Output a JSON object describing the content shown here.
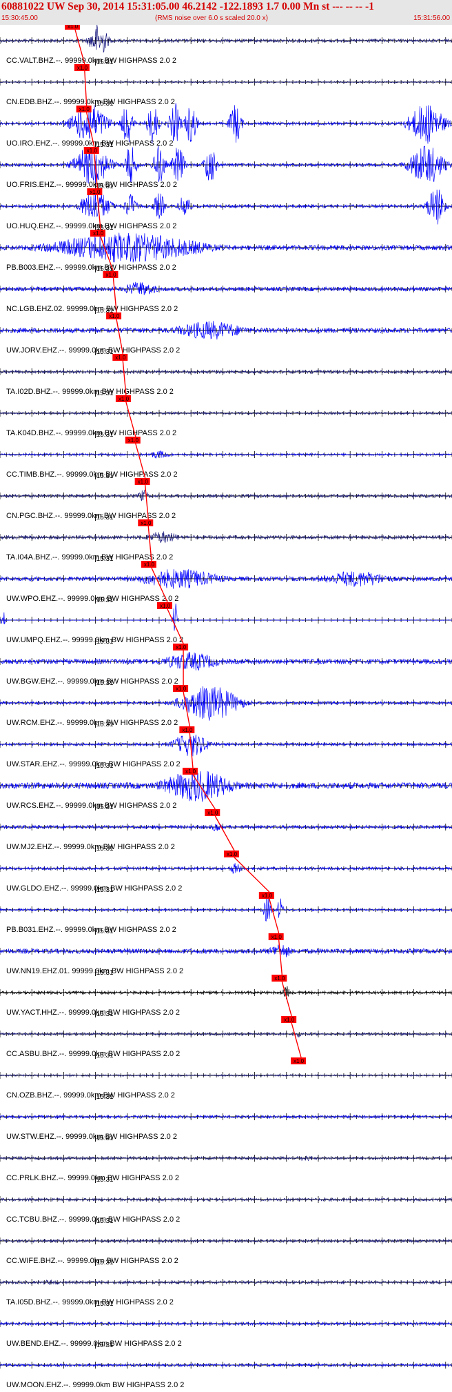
{
  "header": {
    "title": "60881022 UW Sep 30, 2014 15:31:05.00   46.2142 -122.1893  1.7 0.00 Mn st --- -- --  -1",
    "start_time": "15:30:45.00",
    "note": "(RMS noise over 6.0 s scaled 20.0 x)",
    "end_time": "15:31:56.00"
  },
  "colors": {
    "title": "#d40000",
    "trace_blue": "#0000ff",
    "trace_navy": "#1a1a80",
    "pick_red": "#ff0000",
    "header_bg": "#e6e6e6"
  },
  "chart_data": {
    "type": "seismogram",
    "time_range": [
      "15:30:45.00",
      "15:31:56.00"
    ],
    "minute_label": "15:31",
    "pick_label": "x1.0",
    "filter": "99999.0km BW  HIGHPASS  2.0  2",
    "stations": [
      {
        "net": "CC",
        "sta": "VALT",
        "cha": "BHZ",
        "loc": "--",
        "label": "CC.VALT.BHZ.--. 99999.0km BW  HIGHPASS  2.0  2",
        "color": "navy",
        "pick_s": 10.5,
        "events": [
          [
            15.5,
            1.5,
            2.6
          ]
        ],
        "noise": 0.22
      },
      {
        "net": "CN",
        "sta": "EDB",
        "cha": "BHZ",
        "loc": "--",
        "label": "CN.EDB.BHZ.--. 99999.0km BW  HIGHPASS  2.0  2",
        "color": "navy",
        "pick_s": 12.0,
        "events": [],
        "noise": 0.1
      },
      {
        "net": "UO",
        "sta": "IRO",
        "cha": "EHZ",
        "loc": "--",
        "label": "UO.IRO.EHZ.--. 99999.0km BW  HIGHPASS  2.0  2",
        "color": "blue",
        "pick_s": 12.3,
        "events": [
          [
            14,
            3,
            3
          ],
          [
            20,
            1,
            3
          ],
          [
            24,
            1,
            3
          ],
          [
            27.5,
            1,
            3
          ],
          [
            30,
            1,
            3
          ],
          [
            37,
            1,
            3
          ],
          [
            67,
            3,
            3
          ]
        ],
        "noise": 0.2
      },
      {
        "net": "UO",
        "sta": "FRIS",
        "cha": "EHZ",
        "loc": "--",
        "label": "UO.FRIS.EHZ.--. 99999.0km BW  HIGHPASS  2.0  2",
        "color": "blue",
        "pick_s": 13.5,
        "events": [
          [
            14.5,
            3,
            3
          ],
          [
            20.5,
            1,
            3
          ],
          [
            25,
            1,
            3
          ],
          [
            28,
            1,
            3
          ],
          [
            33,
            1,
            3
          ],
          [
            67,
            3,
            3
          ]
        ],
        "noise": 0.22
      },
      {
        "net": "UO",
        "sta": "HUQ",
        "cha": "EHZ",
        "loc": "--",
        "label": "UO.HUQ.EHZ.--. 99999.0km BW  HIGHPASS  2.0  2",
        "color": "blue",
        "pick_s": 14.0,
        "events": [
          [
            15,
            2.5,
            2.5
          ],
          [
            20.5,
            1,
            2
          ],
          [
            25,
            1,
            2
          ],
          [
            29,
            1,
            2
          ],
          [
            68.5,
            1.5,
            3
          ]
        ],
        "noise": 0.22
      },
      {
        "net": "PB",
        "sta": "B003",
        "cha": "EHZ",
        "loc": "--",
        "label": "PB.B003.EHZ.--. 99999.0km BW  HIGHPASS  2.0  2",
        "color": "blue",
        "pick_s": 14.5,
        "events": [
          [
            20,
            13,
            2.2
          ]
        ],
        "noise": 0.35
      },
      {
        "net": "NC",
        "sta": "LGB",
        "cha": "EHZ",
        "loc": "02",
        "label": "NC.LGB.EHZ.02. 99999.0km BW  HIGHPASS  2.0  2",
        "color": "blue",
        "pick_s": 16.5,
        "events": [
          [
            22,
            3,
            1.1
          ]
        ],
        "noise": 0.3
      },
      {
        "net": "UW",
        "sta": "JORV",
        "cha": "EHZ",
        "loc": "--",
        "label": "UW.JORV.EHZ.--. 99999.0km BW  HIGHPASS  2.0  2",
        "color": "blue",
        "pick_s": 17.0,
        "events": [
          [
            33,
            6,
            1.4
          ]
        ],
        "noise": 0.35
      },
      {
        "net": "TA",
        "sta": "I02D",
        "cha": "BHZ",
        "loc": "--",
        "label": "TA.I02D.BHZ.--. 99999.0km BW  HIGHPASS  2.0  2",
        "color": "navy",
        "pick_s": 18.0,
        "events": [],
        "noise": 0.22
      },
      {
        "net": "TA",
        "sta": "K04D",
        "cha": "BHZ",
        "loc": "--",
        "label": "TA.K04D.BHZ.--. 99999.0km BW  HIGHPASS  2.0  2",
        "color": "navy",
        "pick_s": 18.5,
        "events": [],
        "noise": 0.15
      },
      {
        "net": "CC",
        "sta": "TIMB",
        "cha": "BHZ",
        "loc": "--",
        "label": "CC.TIMB.BHZ.--. 99999.0km BW  HIGHPASS  2.0  2",
        "color": "blue",
        "pick_s": 20.0,
        "events": [
          [
            25,
            2,
            0.6
          ]
        ],
        "noise": 0.15
      },
      {
        "net": "CN",
        "sta": "PGC",
        "cha": "BHZ",
        "loc": "--",
        "label": "CN.PGC.BHZ.--. 99999.0km BW  HIGHPASS  2.0  2",
        "color": "navy",
        "pick_s": 21.5,
        "events": [
          [
            22.5,
            1,
            0.9
          ]
        ],
        "noise": 0.22
      },
      {
        "net": "TA",
        "sta": "I04A",
        "cha": "BHZ",
        "loc": "--",
        "label": "TA.I04A.BHZ.--. 99999.0km BW  HIGHPASS  2.0  2",
        "color": "navy",
        "pick_s": 22.0,
        "events": [
          [
            25.5,
            3,
            0.9
          ]
        ],
        "noise": 0.25
      },
      {
        "net": "UW",
        "sta": "WPO",
        "cha": "EHZ",
        "loc": "--",
        "label": "UW.WPO.EHZ.--. 99999.0km BW  HIGHPASS  2.0  2",
        "color": "blue",
        "pick_s": 22.5,
        "events": [
          [
            28,
            7,
            1.5
          ],
          [
            56,
            6,
            1.2
          ]
        ],
        "noise": 0.3
      },
      {
        "net": "UW",
        "sta": "UMPQ",
        "cha": "EHZ",
        "loc": "--",
        "label": "UW.UMPQ.EHZ.--. 99999.0km BW  HIGHPASS  2.0  2",
        "color": "blue",
        "pick_s": 25.0,
        "events": [
          [
            27.5,
            0.3,
            3
          ],
          [
            0.5,
            0.3,
            1.5
          ]
        ],
        "noise": 0.04
      },
      {
        "net": "UW",
        "sta": "BGW",
        "cha": "EHZ",
        "loc": "--",
        "label": "UW.BGW.EHZ.--. 99999.0km BW  HIGHPASS  2.0  2",
        "color": "blue",
        "pick_s": 27.5,
        "events": [
          [
            30,
            5,
            1.4
          ]
        ],
        "noise": 0.35
      },
      {
        "net": "UW",
        "sta": "RCM",
        "cha": "EHZ",
        "loc": "--",
        "label": "UW.RCM.EHZ.--. 99999.0km BW  HIGHPASS  2.0  2",
        "color": "blue",
        "pick_s": 27.5,
        "events": [
          [
            33,
            5,
            2.6
          ]
        ],
        "noise": 0.22
      },
      {
        "net": "UW",
        "sta": "STAR",
        "cha": "EHZ",
        "loc": "--",
        "label": "UW.STAR.EHZ.--. 99999.0km BW  HIGHPASS  2.0  2",
        "color": "blue",
        "pick_s": 28.5,
        "events": [
          [
            30,
            3,
            1.8
          ]
        ],
        "noise": 0.2
      },
      {
        "net": "UW",
        "sta": "RCS",
        "cha": "EHZ",
        "loc": "--",
        "label": "UW.RCS.EHZ.--. 99999.0km BW  HIGHPASS  2.0  2",
        "color": "blue",
        "pick_s": 29.0,
        "events": [
          [
            31,
            6,
            2.4
          ]
        ],
        "noise": 0.45
      },
      {
        "net": "UW",
        "sta": "MJ2",
        "cha": "EHZ",
        "loc": "--",
        "label": "UW.MJ2.EHZ.--. 99999.0km BW  HIGHPASS  2.0  2",
        "color": "blue",
        "pick_s": 32.5,
        "events": [
          [
            34,
            0.8,
            0.8
          ]
        ],
        "noise": 0.25
      },
      {
        "net": "UW",
        "sta": "GLDO",
        "cha": "EHZ",
        "loc": "--",
        "label": "UW.GLDO.EHZ.--. 99999.0km BW  HIGHPASS  2.0  2",
        "color": "blue",
        "pick_s": 35.5,
        "events": [
          [
            37,
            1,
            0.9
          ]
        ],
        "noise": 0.2
      },
      {
        "net": "PB",
        "sta": "B031",
        "cha": "EHZ",
        "loc": "--",
        "label": "PB.B031.EHZ.--. 99999.0km BW  HIGHPASS  2.0  2",
        "color": "blue",
        "pick_s": 41.0,
        "events": [
          [
            42,
            0.6,
            2.2
          ],
          [
            44,
            0.5,
            1.8
          ]
        ],
        "noise": 0.15
      },
      {
        "net": "UW",
        "sta": "NN19",
        "cha": "EHZ",
        "loc": "01",
        "label": "UW.NN19.EHZ.01. 99999.0km BW  HIGHPASS  2.0  2",
        "color": "blue",
        "pick_s": 42.5,
        "events": [
          [
            44,
            2,
            1.2
          ]
        ],
        "noise": 0.35
      },
      {
        "net": "UW",
        "sta": "YACT",
        "cha": "HHZ",
        "loc": "--",
        "label": "UW.YACT.HHZ.--. 99999.0km BW  HIGHPASS  2.0  2",
        "color": "black",
        "pick_s": 43.0,
        "events": [
          [
            45,
            0.7,
            1.0
          ]
        ],
        "noise": 0.18
      },
      {
        "net": "CC",
        "sta": "ASBU",
        "cha": "BHZ",
        "loc": "--",
        "label": "CC.ASBU.BHZ.--. 99999.0km BW  HIGHPASS  2.0  2",
        "color": "navy",
        "pick_s": 44.5,
        "events": [
          [
            47,
            0.5,
            0.5
          ]
        ],
        "noise": 0.18
      },
      {
        "net": "CN",
        "sta": "OZB",
        "cha": "BHZ",
        "loc": "--",
        "label": "CN.OZB.BHZ.--. 99999.0km BW  HIGHPASS  2.0  2",
        "color": "navy",
        "pick_s": 46.0,
        "events": [],
        "noise": 0.12
      },
      {
        "net": "UW",
        "sta": "STW",
        "cha": "EHZ",
        "loc": "--",
        "label": "UW.STW.EHZ.--. 99999.0km BW  HIGHPASS  2.0  2",
        "color": "blue",
        "pick_s": null,
        "events": [],
        "noise": 0.2
      },
      {
        "net": "CC",
        "sta": "PRLK",
        "cha": "BHZ",
        "loc": "--",
        "label": "CC.PRLK.BHZ.--. 99999.0km BW  HIGHPASS  2.0  2",
        "color": "navy",
        "pick_s": null,
        "events": [
          [
            48,
            2,
            0.4
          ]
        ],
        "noise": 0.2
      },
      {
        "net": "CC",
        "sta": "TCBU",
        "cha": "BHZ",
        "loc": "--",
        "label": "CC.TCBU.BHZ.--. 99999.0km BW  HIGHPASS  2.0  2",
        "color": "navy",
        "pick_s": null,
        "events": [],
        "noise": 0.2
      },
      {
        "net": "CC",
        "sta": "WIFE",
        "cha": "BHZ",
        "loc": "--",
        "label": "CC.WIFE.BHZ.--. 99999.0km BW  HIGHPASS  2.0  2",
        "color": "navy",
        "pick_s": null,
        "events": [],
        "noise": 0.2
      },
      {
        "net": "TA",
        "sta": "I05D",
        "cha": "BHZ",
        "loc": "--",
        "label": "TA.I05D.BHZ.--. 99999.0km BW  HIGHPASS  2.0  2",
        "color": "navy",
        "pick_s": null,
        "events": [
          [
            8,
            2,
            0.4
          ]
        ],
        "noise": 0.2
      },
      {
        "net": "UW",
        "sta": "BEND",
        "cha": "EHZ",
        "loc": "--",
        "label": "UW.BEND.EHZ.--. 99999.0km BW  HIGHPASS  2.0  2",
        "color": "blue",
        "pick_s": null,
        "events": [],
        "noise": 0.2
      },
      {
        "net": "UW",
        "sta": "MOON",
        "cha": "EHZ",
        "loc": "--",
        "label": "UW.MOON.EHZ.--. 99999.0km BW  HIGHPASS  2.0  2",
        "color": "blue",
        "pick_s": null,
        "events": [],
        "noise": 0.2
      }
    ]
  }
}
